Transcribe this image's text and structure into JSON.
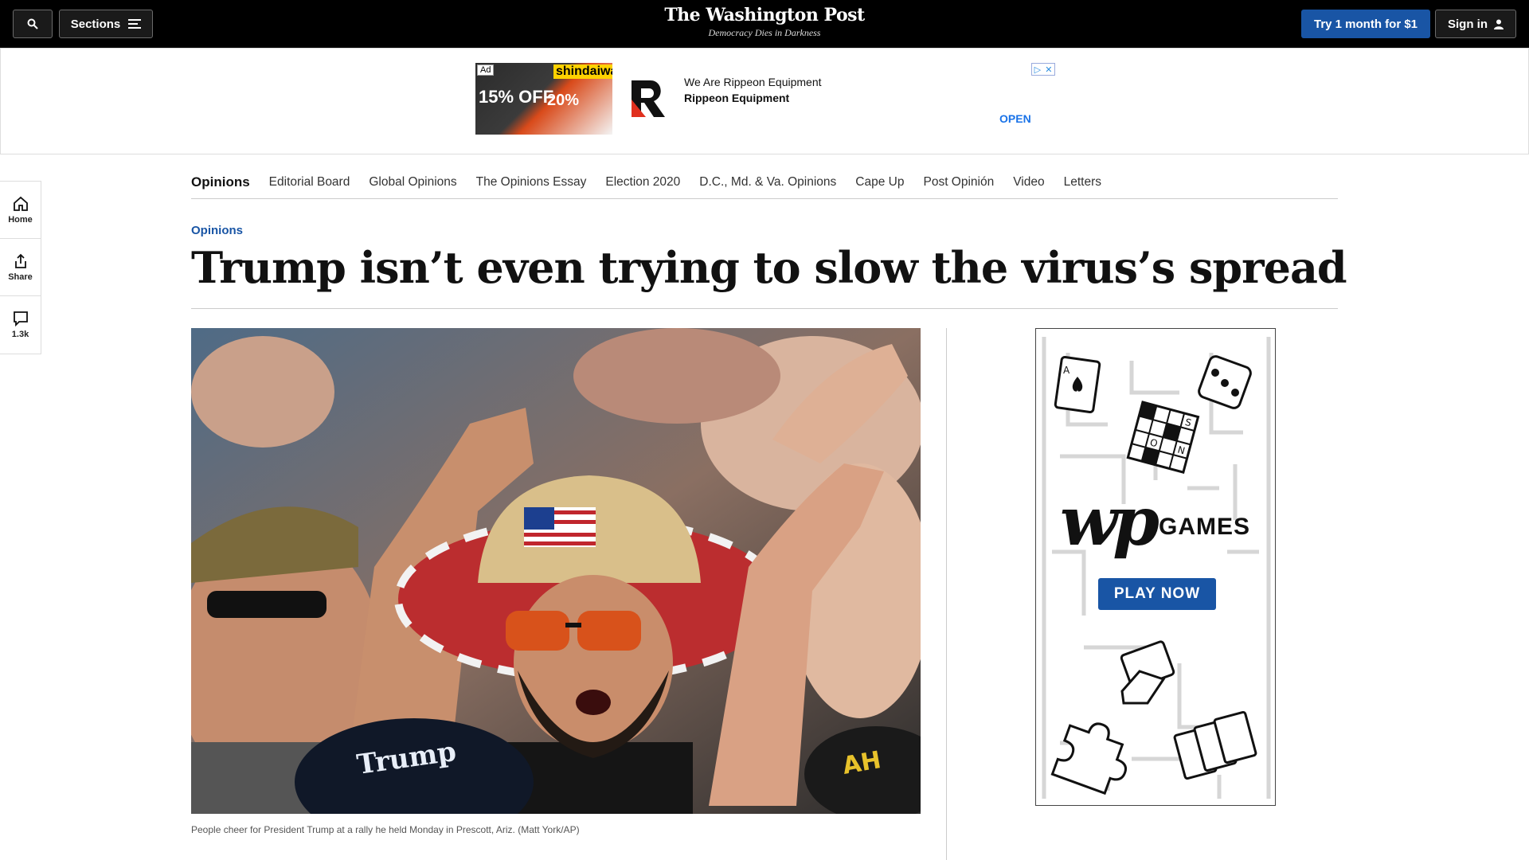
{
  "header": {
    "sections_label": "Sections",
    "logo": "The Washington Post",
    "tagline": "Democracy Dies in Darkness",
    "subscribe_label": "Try 1 month for $1",
    "signin_label": "Sign in"
  },
  "top_ad": {
    "ad_label": "Ad",
    "promo_left": "15% OFF",
    "promo_brand": "shindaiwa",
    "promo_right": "20%",
    "line1": "We Are Rippeon Equipment",
    "line2": "Rippeon Equipment",
    "cta": "OPEN"
  },
  "left_rail": {
    "home": "Home",
    "share": "Share",
    "comments": "1.3k"
  },
  "nav": {
    "items": [
      "Opinions",
      "Editorial Board",
      "Global Opinions",
      "The Opinions Essay",
      "Election 2020",
      "D.C., Md. & Va. Opinions",
      "Cape Up",
      "Post Opinión",
      "Video",
      "Letters"
    ]
  },
  "article": {
    "kicker": "Opinions",
    "headline": "Trump isn’t even trying to slow the virus’s spread",
    "caption": "People cheer for President Trump at a rally he held Monday in Prescott, Ariz. (Matt York/AP)"
  },
  "side_ad": {
    "wordmark": "wp",
    "games_label": "GAMES",
    "play_label": "PLAY NOW"
  },
  "colors": {
    "accent": "#1955a5",
    "topbar": "#000000"
  }
}
